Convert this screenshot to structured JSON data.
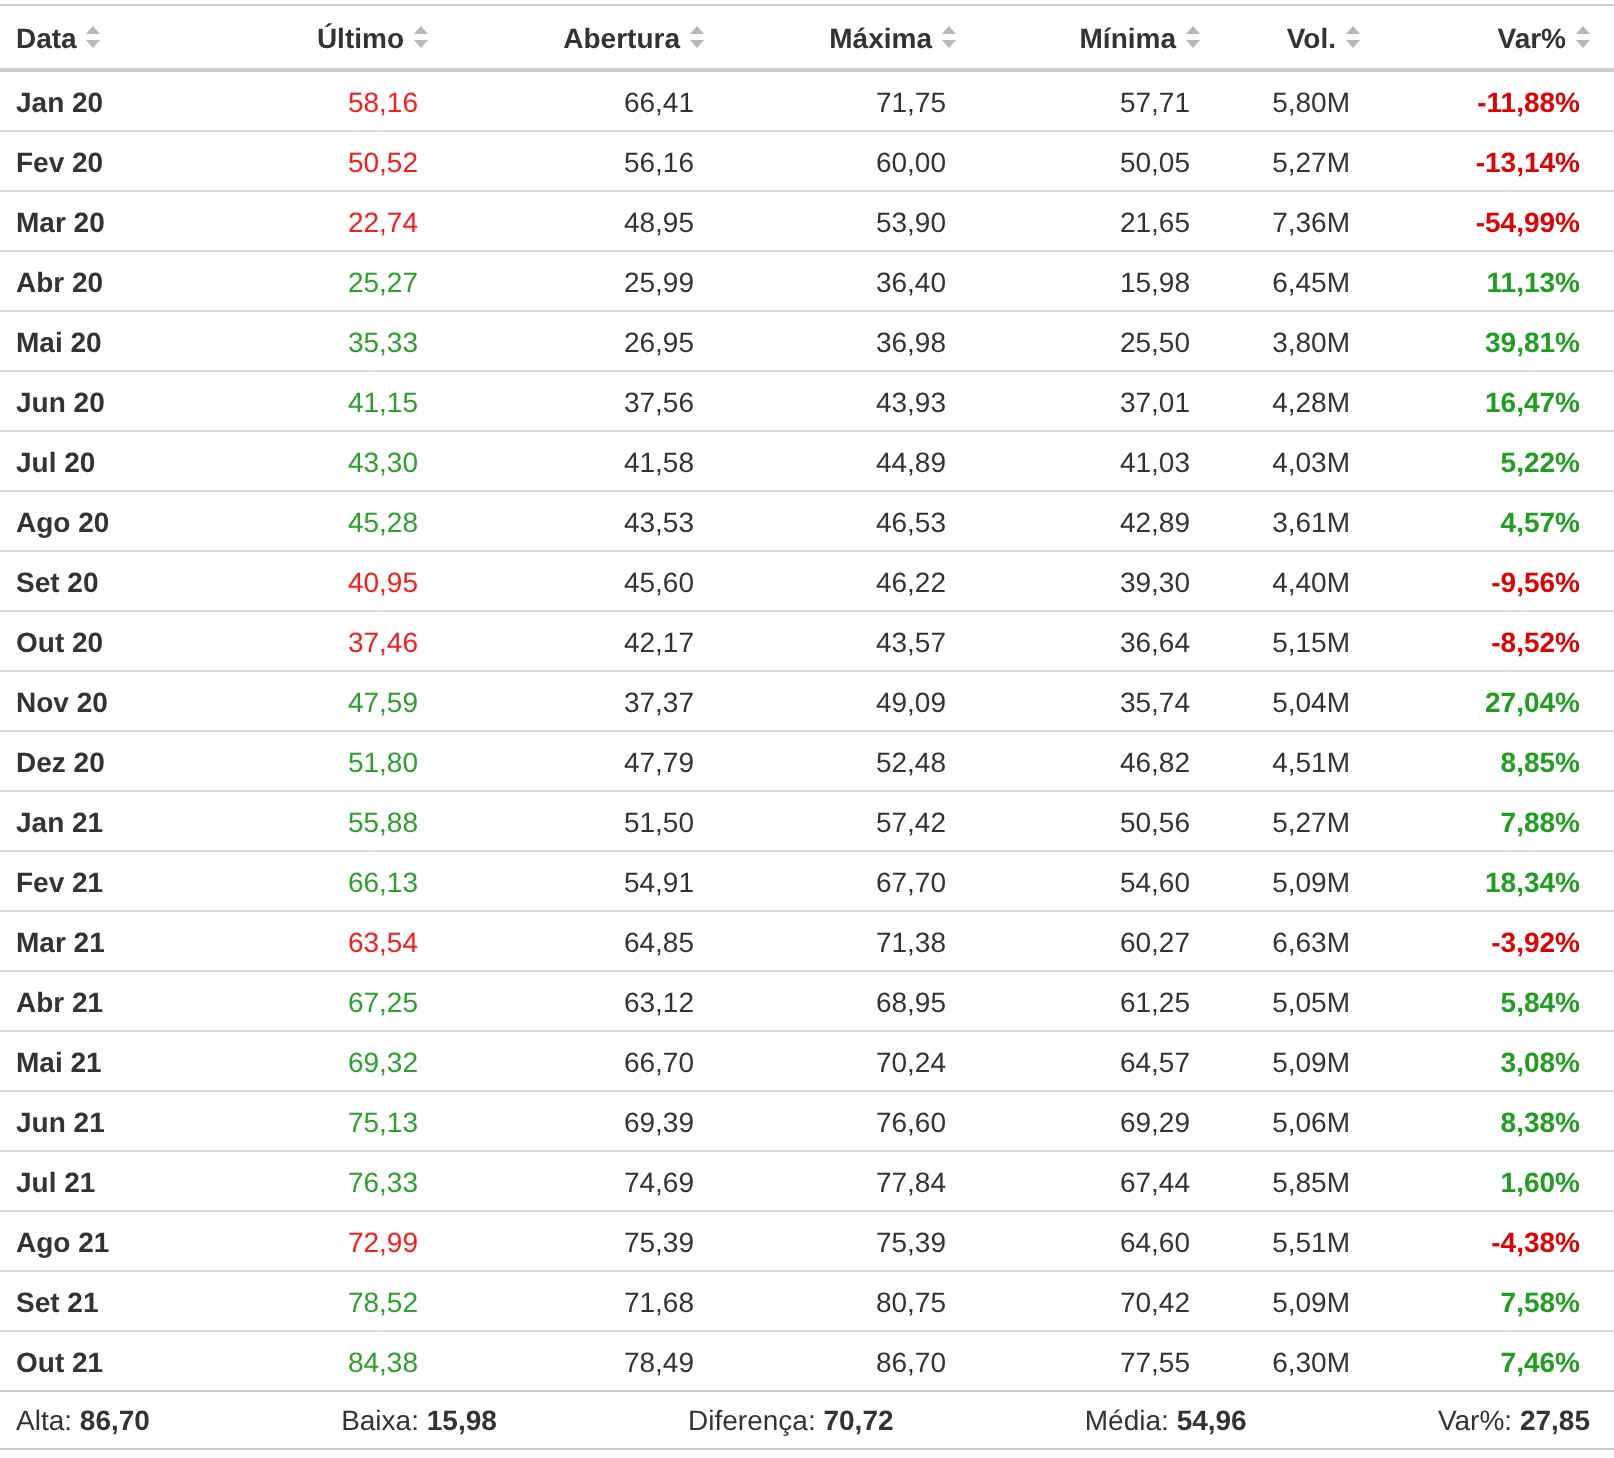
{
  "table": {
    "columns": [
      "Data",
      "Último",
      "Abertura",
      "Máxima",
      "Mínima",
      "Vol.",
      "Var%"
    ],
    "rows": [
      {
        "negative": true,
        "cells": [
          "Jan 20",
          "58,16",
          "66,41",
          "71,75",
          "57,71",
          "5,80M",
          "-11,88%"
        ]
      },
      {
        "negative": true,
        "cells": [
          "Fev 20",
          "50,52",
          "56,16",
          "60,00",
          "50,05",
          "5,27M",
          "-13,14%"
        ]
      },
      {
        "negative": true,
        "cells": [
          "Mar 20",
          "22,74",
          "48,95",
          "53,90",
          "21,65",
          "7,36M",
          "-54,99%"
        ]
      },
      {
        "negative": false,
        "cells": [
          "Abr 20",
          "25,27",
          "25,99",
          "36,40",
          "15,98",
          "6,45M",
          "11,13%"
        ]
      },
      {
        "negative": false,
        "cells": [
          "Mai 20",
          "35,33",
          "26,95",
          "36,98",
          "25,50",
          "3,80M",
          "39,81%"
        ]
      },
      {
        "negative": false,
        "cells": [
          "Jun 20",
          "41,15",
          "37,56",
          "43,93",
          "37,01",
          "4,28M",
          "16,47%"
        ]
      },
      {
        "negative": false,
        "cells": [
          "Jul 20",
          "43,30",
          "41,58",
          "44,89",
          "41,03",
          "4,03M",
          "5,22%"
        ]
      },
      {
        "negative": false,
        "cells": [
          "Ago 20",
          "45,28",
          "43,53",
          "46,53",
          "42,89",
          "3,61M",
          "4,57%"
        ]
      },
      {
        "negative": true,
        "cells": [
          "Set 20",
          "40,95",
          "45,60",
          "46,22",
          "39,30",
          "4,40M",
          "-9,56%"
        ]
      },
      {
        "negative": true,
        "cells": [
          "Out 20",
          "37,46",
          "42,17",
          "43,57",
          "36,64",
          "5,15M",
          "-8,52%"
        ]
      },
      {
        "negative": false,
        "cells": [
          "Nov 20",
          "47,59",
          "37,37",
          "49,09",
          "35,74",
          "5,04M",
          "27,04%"
        ]
      },
      {
        "negative": false,
        "cells": [
          "Dez 20",
          "51,80",
          "47,79",
          "52,48",
          "46,82",
          "4,51M",
          "8,85%"
        ]
      },
      {
        "negative": false,
        "cells": [
          "Jan 21",
          "55,88",
          "51,50",
          "57,42",
          "50,56",
          "5,27M",
          "7,88%"
        ]
      },
      {
        "negative": false,
        "cells": [
          "Fev 21",
          "66,13",
          "54,91",
          "67,70",
          "54,60",
          "5,09M",
          "18,34%"
        ]
      },
      {
        "negative": true,
        "cells": [
          "Mar 21",
          "63,54",
          "64,85",
          "71,38",
          "60,27",
          "6,63M",
          "-3,92%"
        ]
      },
      {
        "negative": false,
        "cells": [
          "Abr 21",
          "67,25",
          "63,12",
          "68,95",
          "61,25",
          "5,05M",
          "5,84%"
        ]
      },
      {
        "negative": false,
        "cells": [
          "Mai 21",
          "69,32",
          "66,70",
          "70,24",
          "64,57",
          "5,09M",
          "3,08%"
        ]
      },
      {
        "negative": false,
        "cells": [
          "Jun 21",
          "75,13",
          "69,39",
          "76,60",
          "69,29",
          "5,06M",
          "8,38%"
        ]
      },
      {
        "negative": false,
        "cells": [
          "Jul 21",
          "76,33",
          "74,69",
          "77,84",
          "67,44",
          "5,85M",
          "1,60%"
        ]
      },
      {
        "negative": true,
        "cells": [
          "Ago 21",
          "72,99",
          "75,39",
          "75,39",
          "64,60",
          "5,51M",
          "-4,38%"
        ]
      },
      {
        "negative": false,
        "cells": [
          "Set 21",
          "78,52",
          "71,68",
          "80,75",
          "70,42",
          "5,09M",
          "7,58%"
        ]
      },
      {
        "negative": false,
        "cells": [
          "Out 21",
          "84,38",
          "78,49",
          "86,70",
          "77,55",
          "6,30M",
          "7,46%"
        ]
      }
    ]
  },
  "summary": [
    {
      "label": "Alta:",
      "value": "86,70"
    },
    {
      "label": "Baixa:",
      "value": "15,98"
    },
    {
      "label": "Diferença:",
      "value": "70,72"
    },
    {
      "label": "Média:",
      "value": "54,96"
    },
    {
      "label": "Var%:",
      "value": "27,85"
    }
  ]
}
